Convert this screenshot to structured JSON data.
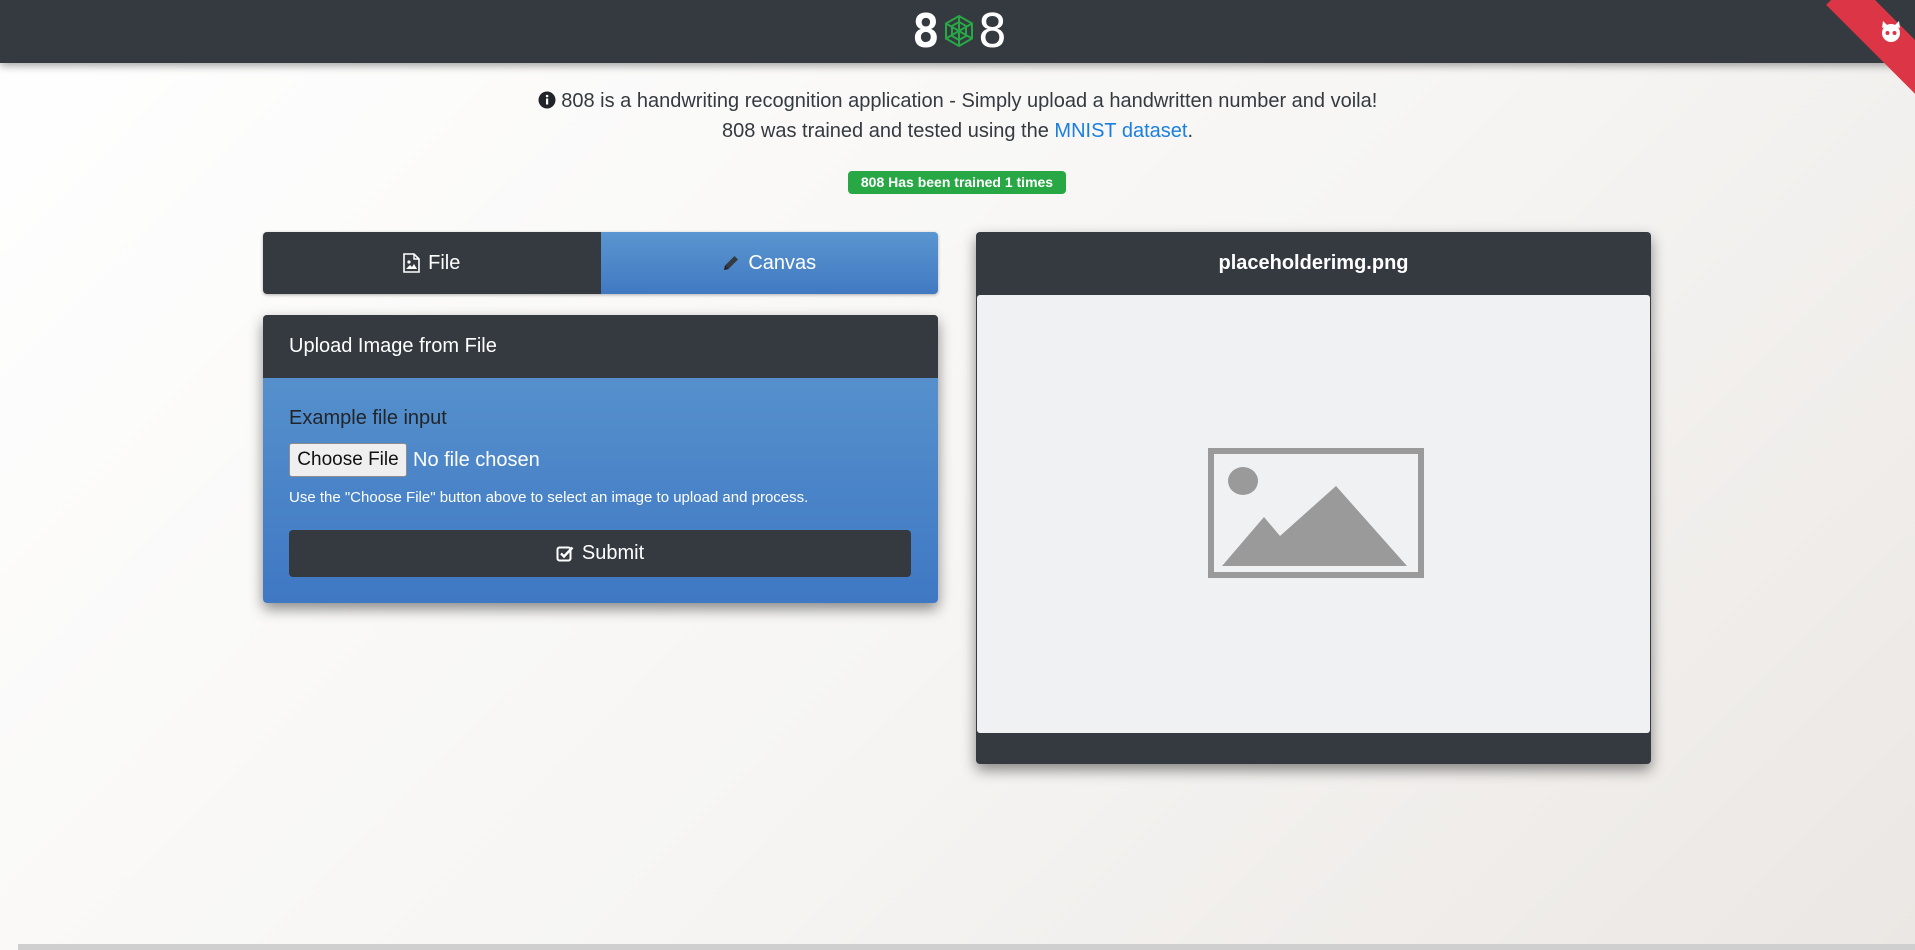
{
  "navbar": {
    "logo": {
      "digit_left": "8",
      "digit_right": "8",
      "middle": "neural-network-icon"
    },
    "corner": {
      "icon": "octocat-icon",
      "color": "#dc3545"
    }
  },
  "intro": {
    "line1": "808 is a handwriting recognition application - Simply upload a handwritten number and voila!",
    "line2_prefix": "808 was trained and tested using the ",
    "line2_link": "MNIST dataset",
    "line2_suffix": "."
  },
  "badge": {
    "text": "808 Has been trained 1 times",
    "color": "#28a745"
  },
  "tabs": [
    {
      "label": "File",
      "icon": "file-image-icon"
    },
    {
      "label": "Canvas",
      "icon": "pencil-icon"
    }
  ],
  "upload_card": {
    "title": "Upload Image from File",
    "file_label": "Example file input",
    "choose_button": "Choose File",
    "file_status": "No file chosen",
    "help_text": "Use the \"Choose File\" button above to select an image to upload and process.",
    "submit_label": "Submit"
  },
  "preview_card": {
    "title": "placeholderimg.png",
    "image": "placeholder-image-icon"
  },
  "colors": {
    "dark": "#343a40",
    "blue": "#4a86c8",
    "link": "#1a7fe0"
  }
}
